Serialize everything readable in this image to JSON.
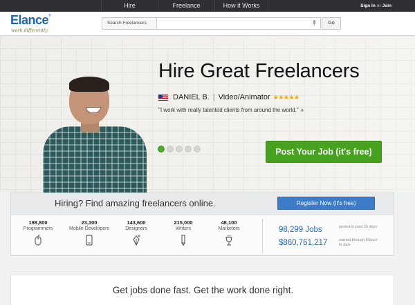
{
  "topnav": {
    "items": [
      "Hire",
      "Freelance",
      "How it Works"
    ],
    "sign_in": "Sign In",
    "or": "or",
    "join": "Join"
  },
  "header": {
    "logo_text": "Elance",
    "logo_tm": "®",
    "tagline": "work differently",
    "search_category": "Search Freelancers",
    "search_placeholder": "",
    "go_label": "Go"
  },
  "hero": {
    "title": "Hire Great Freelancers",
    "freelancer_name": "DANIEL B.",
    "freelancer_role": "Video/Animator",
    "rating_stars": "★★★★★",
    "quote": "\"I work with really talented clients from around the world.\"",
    "quote_arrow": "»",
    "slides": 5,
    "active_slide": 1,
    "cta_label": "Post Your Job (it's free)",
    "cta_color": "#46a21e"
  },
  "band": {
    "text": "Hiring? Find amazing freelancers online.",
    "register_label": "Register Now (it's free)"
  },
  "stats": {
    "items": [
      {
        "num": "198,800",
        "label": "Programmers",
        "icon": "mouse-icon"
      },
      {
        "num": "23,300",
        "label": "Mobile Developers",
        "icon": "phone-icon"
      },
      {
        "num": "143,600",
        "label": "Designers",
        "icon": "pen-nib-icon"
      },
      {
        "num": "215,000",
        "label": "Writers",
        "icon": "pencil-icon"
      },
      {
        "num": "48,100",
        "label": "Marketers",
        "icon": "trophy-icon"
      }
    ],
    "jobs": "98,299 Jobs",
    "jobs_note_1": "posted in past 30 days",
    "earned": "$860,761,217",
    "earned_note_1": "earned through Elance",
    "earned_note_2": "to date"
  },
  "lower": {
    "tagline": "Get jobs done fast. Get the work done right."
  }
}
